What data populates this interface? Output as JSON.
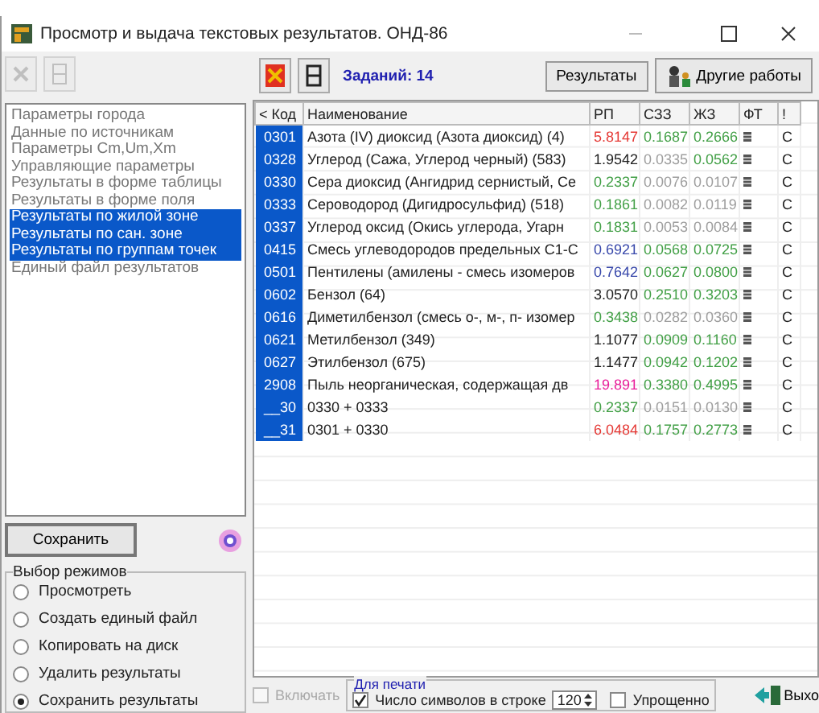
{
  "window": {
    "title": "Просмотр и выдача текстовых результатов. ОНД-86"
  },
  "toolbar": {
    "tasks": "Заданий: 14",
    "buttons": [
      "Результаты",
      "Другие работы"
    ]
  },
  "sidebar": {
    "items": [
      {
        "label": "Параметры города",
        "selected": false
      },
      {
        "label": "Данные по источникам",
        "selected": false
      },
      {
        "label": "Параметры Cm,Um,Xm",
        "selected": false
      },
      {
        "label": "Управляющие параметры",
        "selected": false
      },
      {
        "label": "Результаты в форме таблицы",
        "selected": false
      },
      {
        "label": "Результаты в форме поля",
        "selected": false
      },
      {
        "label": "Результаты по жилой зоне",
        "selected": true
      },
      {
        "label": "Результаты по сан. зоне",
        "selected": true
      },
      {
        "label": "Результаты по группам точек",
        "selected": true
      },
      {
        "label": "Единый файл результатов",
        "selected": false
      }
    ],
    "save_button": "Сохранить",
    "modes": {
      "title": "Выбор режимов",
      "options": [
        {
          "label": "Просмотреть",
          "selected": false
        },
        {
          "label": "Создать единый файл",
          "selected": false
        },
        {
          "label": "Копировать на диск",
          "selected": false
        },
        {
          "label": "Удалить результаты",
          "selected": false
        },
        {
          "label": "Сохранить результаты",
          "selected": true
        }
      ]
    }
  },
  "table": {
    "columns": [
      "< Код",
      "Наименование",
      "РП",
      "СЗЗ",
      "ЖЗ",
      "ФТ",
      "!"
    ],
    "rows": [
      {
        "code": "0301",
        "name": "Азота (IV) диоксид (Азота диоксид) (4)",
        "values": [
          {
            "text": "5.8147",
            "color": "#e53935"
          },
          {
            "text": "0.1687",
            "color": "#43a047"
          },
          {
            "text": "0.2666",
            "color": "#43a047"
          }
        ],
        "last": "С"
      },
      {
        "code": "0328",
        "name": "Углерод (Сажа, Углерод черный) (583)",
        "values": [
          {
            "text": "1.9542",
            "color": "#222222"
          },
          {
            "text": "0.0335",
            "color": "#9e9e9e"
          },
          {
            "text": "0.0562",
            "color": "#43a047"
          }
        ],
        "last": "С"
      },
      {
        "code": "0330",
        "name": "Сера диоксид (Ангидрид сернистый, Се",
        "values": [
          {
            "text": "0.2337",
            "color": "#43a047"
          },
          {
            "text": "0.0076",
            "color": "#9e9e9e"
          },
          {
            "text": "0.0107",
            "color": "#9e9e9e"
          }
        ],
        "last": "С"
      },
      {
        "code": "0333",
        "name": "Сероводород (Дигидросульфид) (518)",
        "values": [
          {
            "text": "0.1861",
            "color": "#43a047"
          },
          {
            "text": "0.0082",
            "color": "#9e9e9e"
          },
          {
            "text": "0.0119",
            "color": "#9e9e9e"
          }
        ],
        "last": "С"
      },
      {
        "code": "0337",
        "name": "Углерод оксид (Окись углерода, Угарн",
        "values": [
          {
            "text": "0.1831",
            "color": "#43a047"
          },
          {
            "text": "0.0053",
            "color": "#9e9e9e"
          },
          {
            "text": "0.0084",
            "color": "#9e9e9e"
          }
        ],
        "last": "С"
      },
      {
        "code": "0415",
        "name": "Смесь углеводородов предельных С1-С",
        "values": [
          {
            "text": "0.6921",
            "color": "#3949ab"
          },
          {
            "text": "0.0568",
            "color": "#43a047"
          },
          {
            "text": "0.0725",
            "color": "#43a047"
          }
        ],
        "last": "С"
      },
      {
        "code": "0501",
        "name": "Пентилены (амилены - смесь изомеров",
        "values": [
          {
            "text": "0.7642",
            "color": "#3949ab"
          },
          {
            "text": "0.0627",
            "color": "#43a047"
          },
          {
            "text": "0.0800",
            "color": "#43a047"
          }
        ],
        "last": "С"
      },
      {
        "code": "0602",
        "name": "Бензол (64)",
        "values": [
          {
            "text": "3.0570",
            "color": "#222222"
          },
          {
            "text": "0.2510",
            "color": "#43a047"
          },
          {
            "text": "0.3203",
            "color": "#43a047"
          }
        ],
        "last": "С"
      },
      {
        "code": "0616",
        "name": "Диметилбензол (смесь о-, м-, п- изомер",
        "values": [
          {
            "text": "0.3438",
            "color": "#43a047"
          },
          {
            "text": "0.0282",
            "color": "#9e9e9e"
          },
          {
            "text": "0.0360",
            "color": "#9e9e9e"
          }
        ],
        "last": "С"
      },
      {
        "code": "0621",
        "name": "Метилбензол (349)",
        "values": [
          {
            "text": "1.1077",
            "color": "#222222"
          },
          {
            "text": "0.0909",
            "color": "#43a047"
          },
          {
            "text": "0.1160",
            "color": "#43a047"
          }
        ],
        "last": "С"
      },
      {
        "code": "0627",
        "name": "Этилбензол (675)",
        "values": [
          {
            "text": "1.1477",
            "color": "#222222"
          },
          {
            "text": "0.0942",
            "color": "#43a047"
          },
          {
            "text": "0.1202",
            "color": "#43a047"
          }
        ],
        "last": "С"
      },
      {
        "code": "2908",
        "name": "Пыль неорганическая, содержащая дв",
        "values": [
          {
            "text": "19.891",
            "color": "#e91e9a"
          },
          {
            "text": "0.3380",
            "color": "#43a047"
          },
          {
            "text": "0.4995",
            "color": "#43a047"
          }
        ],
        "last": "С"
      },
      {
        "code": "__30",
        "name": "0330 + 0333",
        "values": [
          {
            "text": "0.2337",
            "color": "#43a047"
          },
          {
            "text": "0.0151",
            "color": "#9e9e9e"
          },
          {
            "text": "0.0130",
            "color": "#9e9e9e"
          }
        ],
        "last": "С"
      },
      {
        "code": "__31",
        "name": "0301 + 0330",
        "values": [
          {
            "text": "6.0484",
            "color": "#e53935"
          },
          {
            "text": "0.1757",
            "color": "#43a047"
          },
          {
            "text": "0.2773",
            "color": "#43a047"
          }
        ],
        "last": "С"
      }
    ]
  },
  "bottom": {
    "include": {
      "label": "Включать",
      "checked": false,
      "disabled": true
    },
    "print_group": "Для печати",
    "chars": {
      "label": "Число символов в строке",
      "checked": true,
      "value": "120"
    },
    "simple": {
      "label": "Упрощенно",
      "checked": false
    },
    "exit": "Выхо"
  }
}
